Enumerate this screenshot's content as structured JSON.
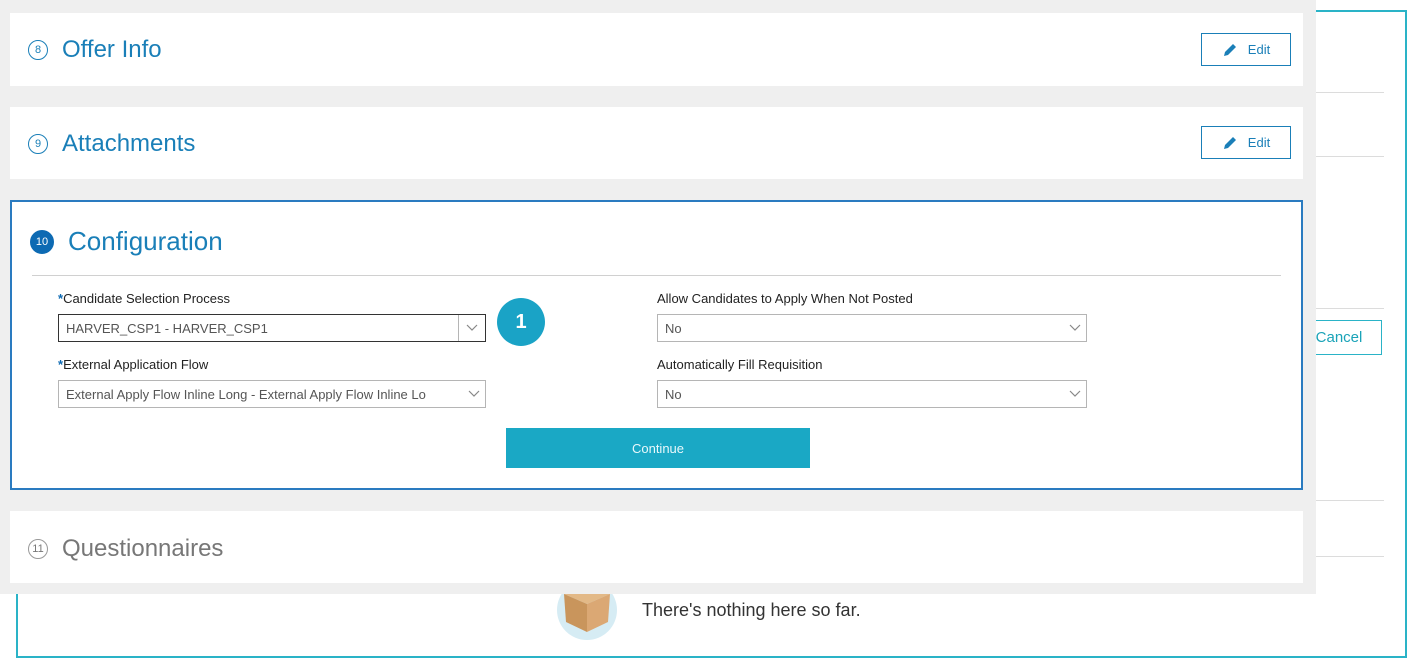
{
  "background": {
    "cancel_label": "Cancel",
    "empty_message": "There's nothing here so far."
  },
  "sections": {
    "offer_info": {
      "number": "8",
      "title": "Offer Info",
      "edit_label": "Edit"
    },
    "attachments": {
      "number": "9",
      "title": "Attachments",
      "edit_label": "Edit"
    },
    "configuration": {
      "number": "10",
      "title": "Configuration",
      "candidate_selection": {
        "required_mark": "*",
        "label": "Candidate Selection Process",
        "value": "HARVER_CSP1 - HARVER_CSP1"
      },
      "external_flow": {
        "required_mark": "*",
        "label": "External Application Flow",
        "value": "External Apply Flow Inline Long - External Apply Flow Inline Lo"
      },
      "allow_apply": {
        "label": "Allow Candidates to Apply When Not Posted",
        "value": "No"
      },
      "auto_fill": {
        "label": "Automatically Fill Requisition",
        "value": "No"
      },
      "continue_label": "Continue",
      "badge": "1"
    },
    "questionnaires": {
      "number": "11",
      "title": "Questionnaires"
    }
  },
  "colors": {
    "accent": "#1a7fb8",
    "teal": "#1aa8c5",
    "active_step": "#0d6ab3"
  }
}
